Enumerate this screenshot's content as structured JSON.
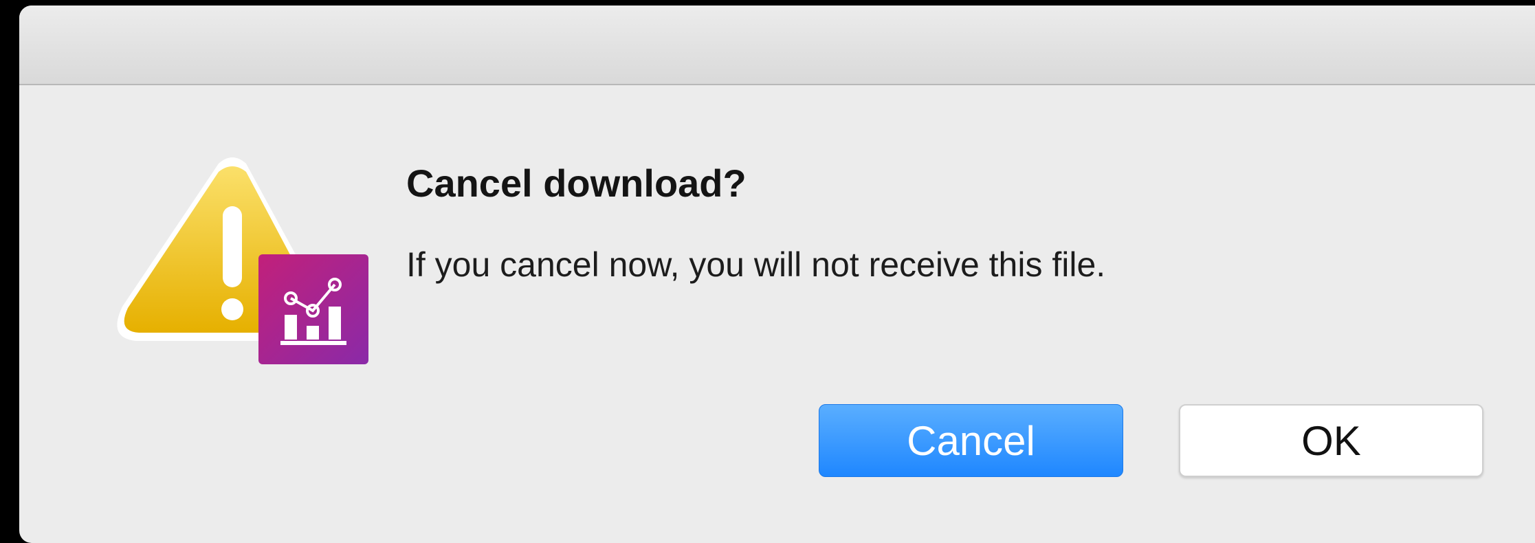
{
  "dialog": {
    "title": "Cancel download?",
    "message": "If you cancel now, you will not receive this file.",
    "buttons": {
      "cancel_label": "Cancel",
      "ok_label": "OK"
    },
    "icons": {
      "alert": "warning-triangle-icon",
      "app": "analytics-chart-icon"
    }
  },
  "colors": {
    "primary_button": "#2a8cff",
    "warning_yellow": "#f2c21a",
    "app_badge": "#b0216f"
  }
}
